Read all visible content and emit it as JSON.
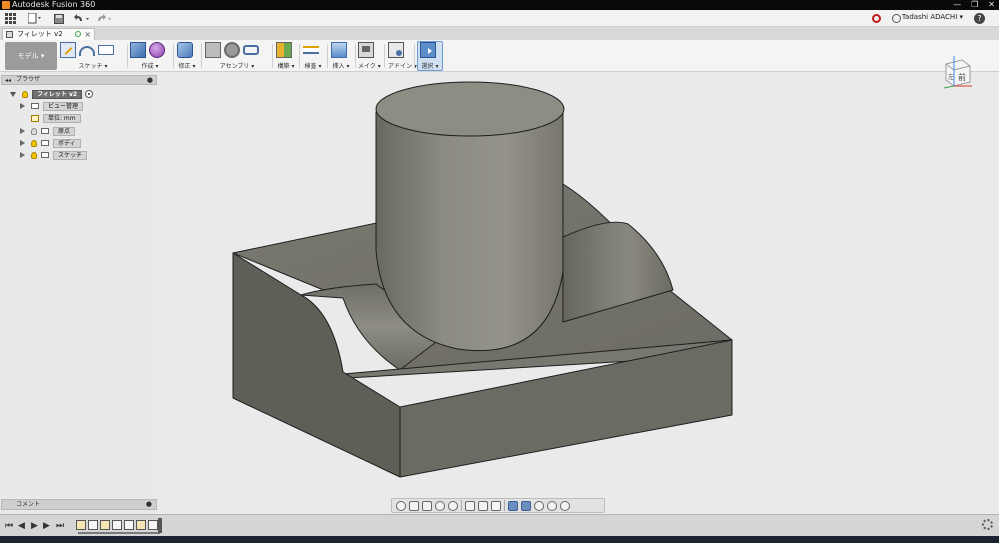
{
  "window": {
    "title": "Autodesk Fusion 360",
    "controls": [
      "—",
      "❐",
      "✕"
    ]
  },
  "quick_access": {
    "user_name": "Tadashi ADACHI ▾",
    "help_label": "?"
  },
  "document_tab": {
    "label": "フィレット v2",
    "close": "×"
  },
  "toolbar": {
    "workspace_label": "モデル ▾",
    "groups": [
      {
        "label": "スケッチ ▾"
      },
      {
        "label": "作成 ▾"
      },
      {
        "label": "修正 ▾"
      },
      {
        "label": "アセンブリ ▾"
      },
      {
        "label": "構築 ▾"
      },
      {
        "label": "検査 ▾"
      },
      {
        "label": "挿入 ▾"
      },
      {
        "label": "メイク ▾"
      },
      {
        "label": "アドイン ▾"
      },
      {
        "label": "選択 ▾"
      }
    ]
  },
  "browser": {
    "title": "ブラウザ",
    "root": {
      "label": "フィレット v2"
    },
    "items": [
      {
        "label": "ビュー管理"
      },
      {
        "label": "単位: mm"
      },
      {
        "label": "原点"
      },
      {
        "label": "ボディ"
      },
      {
        "label": "スケッチ"
      }
    ]
  },
  "comments": {
    "title": "コメント"
  },
  "viewcube": {
    "face_left": "左",
    "face_front": "前"
  },
  "colors": {
    "model_face": "#6f6e66",
    "model_top": "#8a8980",
    "background": "#eaeaea",
    "accent_select": "#5b8dc9"
  }
}
